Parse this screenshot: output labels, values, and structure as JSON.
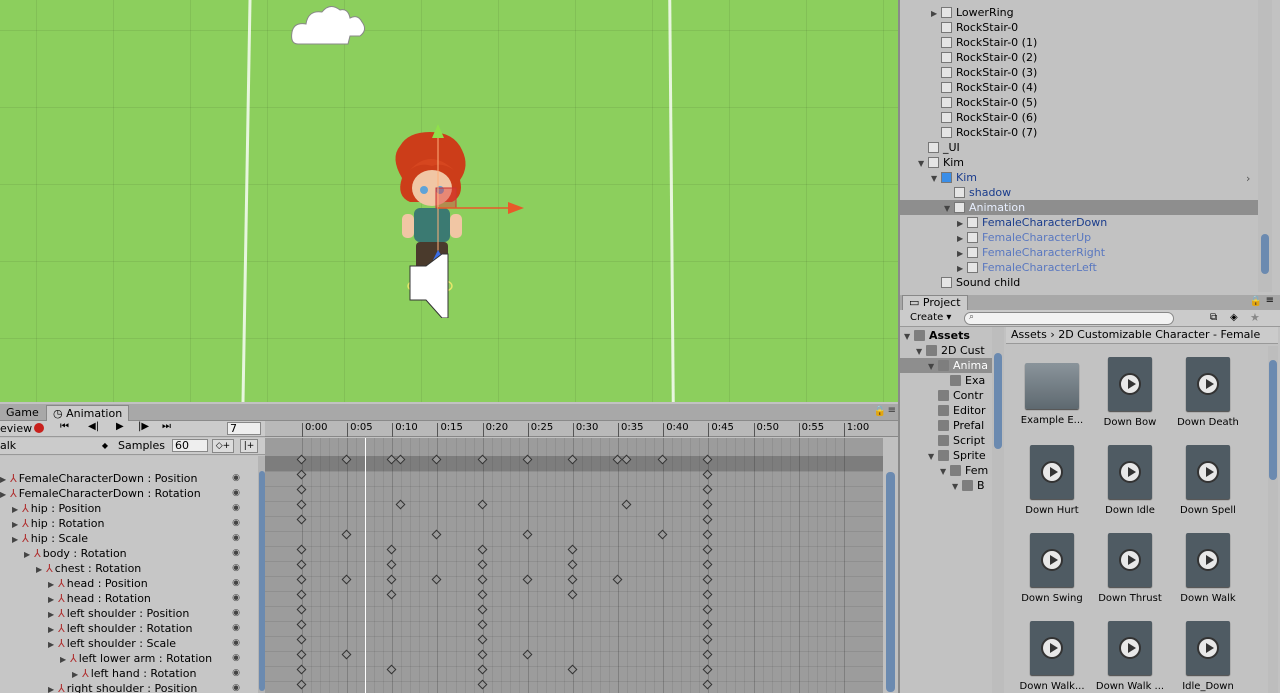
{
  "game_tab": "Game",
  "animation_tab": "Animation",
  "anim": {
    "preview_label": "eview",
    "frame": "7",
    "clip": "alk",
    "samples_label": "Samples",
    "samples": "60",
    "ruler": [
      "0:00",
      "0:05",
      "0:10",
      "0:15",
      "0:20",
      "0:25",
      "0:30",
      "0:35",
      "0:40",
      "0:45",
      "0:50",
      "0:55",
      "1:00"
    ],
    "properties": [
      {
        "label": "FemaleCharacterDown : Position",
        "indent": 0
      },
      {
        "label": "FemaleCharacterDown : Rotation",
        "indent": 0
      },
      {
        "label": "hip : Position",
        "indent": 1
      },
      {
        "label": "hip : Rotation",
        "indent": 1
      },
      {
        "label": "hip : Scale",
        "indent": 1
      },
      {
        "label": "body : Rotation",
        "indent": 2
      },
      {
        "label": "chest : Rotation",
        "indent": 3
      },
      {
        "label": "head : Position",
        "indent": 4
      },
      {
        "label": "head : Rotation",
        "indent": 4
      },
      {
        "label": "left shoulder : Position",
        "indent": 4
      },
      {
        "label": "left shoulder : Rotation",
        "indent": 4
      },
      {
        "label": "left shoulder : Scale",
        "indent": 4
      },
      {
        "label": "left lower arm : Rotation",
        "indent": 5
      },
      {
        "label": "left hand : Rotation",
        "indent": 6
      },
      {
        "label": "right shoulder : Position",
        "indent": 4
      }
    ],
    "summary_keys": [
      0,
      5,
      10,
      11,
      15,
      20,
      25,
      30,
      35,
      36,
      40,
      45
    ],
    "row_keys": [
      [
        0,
        45
      ],
      [
        0,
        45
      ],
      [
        0,
        11,
        20,
        36,
        45
      ],
      [
        0,
        45
      ],
      [
        5,
        15,
        25,
        40,
        45
      ],
      [
        0,
        10,
        20,
        30,
        45
      ],
      [
        0,
        10,
        20,
        30,
        45
      ],
      [
        0,
        5,
        10,
        15,
        20,
        25,
        30,
        35,
        45
      ],
      [
        0,
        10,
        20,
        30,
        45
      ],
      [
        0,
        20,
        45
      ],
      [
        0,
        20,
        45
      ],
      [
        0,
        20,
        45
      ],
      [
        0,
        5,
        20,
        25,
        45
      ],
      [
        0,
        10,
        20,
        30,
        45
      ],
      [
        0,
        20,
        45
      ]
    ]
  },
  "hierarchy": [
    {
      "label": "LowerRing",
      "indent": 1,
      "arrow": "right",
      "style": "normal"
    },
    {
      "label": "RockStair-0",
      "indent": 1,
      "arrow": "",
      "style": "normal"
    },
    {
      "label": "RockStair-0 (1)",
      "indent": 1,
      "arrow": "",
      "style": "normal"
    },
    {
      "label": "RockStair-0 (2)",
      "indent": 1,
      "arrow": "",
      "style": "normal"
    },
    {
      "label": "RockStair-0 (3)",
      "indent": 1,
      "arrow": "",
      "style": "normal"
    },
    {
      "label": "RockStair-0 (4)",
      "indent": 1,
      "arrow": "",
      "style": "normal"
    },
    {
      "label": "RockStair-0 (5)",
      "indent": 1,
      "arrow": "",
      "style": "normal"
    },
    {
      "label": "RockStair-0 (6)",
      "indent": 1,
      "arrow": "",
      "style": "normal"
    },
    {
      "label": "RockStair-0 (7)",
      "indent": 1,
      "arrow": "",
      "style": "normal"
    },
    {
      "label": "_UI",
      "indent": 0,
      "arrow": "",
      "style": "normal"
    },
    {
      "label": "Kim",
      "indent": 0,
      "arrow": "down",
      "style": "normal"
    },
    {
      "label": "Kim",
      "indent": 1,
      "arrow": "down",
      "style": "prefab"
    },
    {
      "label": "shadow",
      "indent": 2,
      "arrow": "",
      "style": "prefab"
    },
    {
      "label": "Animation",
      "indent": 2,
      "arrow": "down",
      "style": "selected"
    },
    {
      "label": "FemaleCharacterDown",
      "indent": 3,
      "arrow": "right",
      "style": "prefab"
    },
    {
      "label": "FemaleCharacterUp",
      "indent": 3,
      "arrow": "right",
      "style": "faded"
    },
    {
      "label": "FemaleCharacterRight",
      "indent": 3,
      "arrow": "right",
      "style": "faded"
    },
    {
      "label": "FemaleCharacterLeft",
      "indent": 3,
      "arrow": "right",
      "style": "faded"
    },
    {
      "label": "Sound child",
      "indent": 1,
      "arrow": "",
      "style": "normal"
    }
  ],
  "project": {
    "tab": "Project",
    "create": "Create",
    "breadcrumb_root": "Assets",
    "breadcrumb_folder": "2D Customizable Character - Female",
    "tree": [
      {
        "label": "Assets",
        "indent": 0,
        "arrow": "down",
        "bold": true
      },
      {
        "label": "2D Cust",
        "indent": 1,
        "arrow": "down"
      },
      {
        "label": "Anima",
        "indent": 2,
        "arrow": "down",
        "selected": true
      },
      {
        "label": "Exa",
        "indent": 3,
        "arrow": ""
      },
      {
        "label": "Contr",
        "indent": 2,
        "arrow": ""
      },
      {
        "label": "Editor",
        "indent": 2,
        "arrow": ""
      },
      {
        "label": "Prefal",
        "indent": 2,
        "arrow": ""
      },
      {
        "label": "Script",
        "indent": 2,
        "arrow": ""
      },
      {
        "label": "Sprite",
        "indent": 2,
        "arrow": "down"
      },
      {
        "label": "Fem",
        "indent": 3,
        "arrow": "down"
      },
      {
        "label": "B",
        "indent": 4,
        "arrow": "down"
      }
    ],
    "assets": [
      {
        "label": "Example E...",
        "kind": "folder"
      },
      {
        "label": "Down Bow",
        "kind": "anim"
      },
      {
        "label": "Down Death",
        "kind": "anim"
      },
      {
        "label": "Down Hurt",
        "kind": "anim"
      },
      {
        "label": "Down Idle",
        "kind": "anim"
      },
      {
        "label": "Down Spell",
        "kind": "anim"
      },
      {
        "label": "Down Swing",
        "kind": "anim"
      },
      {
        "label": "Down Thrust",
        "kind": "anim"
      },
      {
        "label": "Down Walk",
        "kind": "anim"
      },
      {
        "label": "Down Walk...",
        "kind": "anim"
      },
      {
        "label": "Down Walk ...",
        "kind": "anim"
      },
      {
        "label": "Idle_Down",
        "kind": "anim"
      }
    ]
  }
}
